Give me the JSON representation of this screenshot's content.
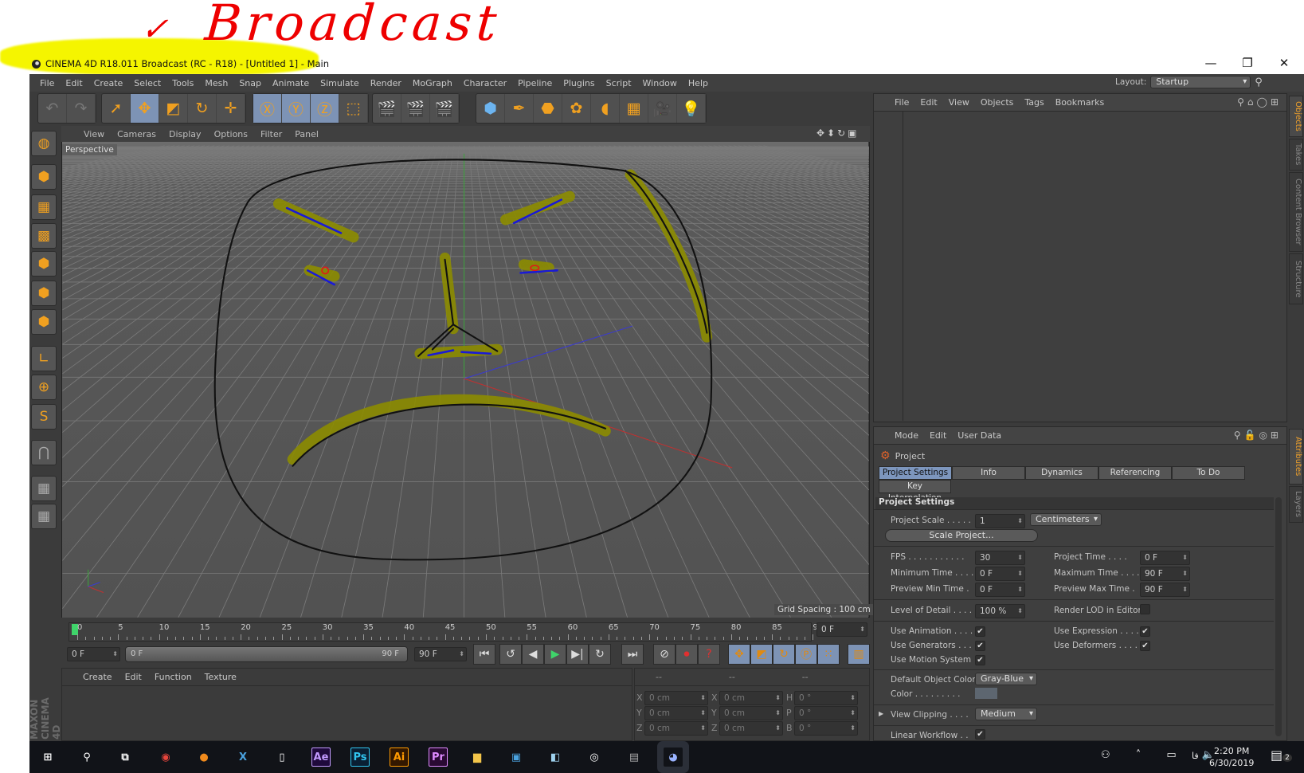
{
  "annotation": {
    "text": "Broadcast",
    "mark": "✓"
  },
  "window": {
    "title": "CINEMA 4D R18.011 Broadcast (RC - R18) - [Untitled 1] - Main",
    "minimize": "—",
    "restore": "❐",
    "close": "✕"
  },
  "menubar": [
    "File",
    "Edit",
    "Create",
    "Select",
    "Tools",
    "Mesh",
    "Snap",
    "Animate",
    "Simulate",
    "Render",
    "MoGraph",
    "Character",
    "Pipeline",
    "Plugins",
    "Script",
    "Window",
    "Help"
  ],
  "layout": {
    "label": "Layout:",
    "value": "Startup"
  },
  "toolbar_groups": [
    [
      {
        "icon": "undo-icon",
        "g": "↶"
      },
      {
        "icon": "redo-icon",
        "g": "↷"
      }
    ],
    [
      {
        "icon": "live-selection-icon",
        "g": "➚"
      },
      {
        "icon": "move-icon",
        "g": "✥",
        "sel": true
      },
      {
        "icon": "scale-icon",
        "g": "◩"
      },
      {
        "icon": "rotate-icon",
        "g": "↻"
      },
      {
        "icon": "recent-tool-icon",
        "g": "✛"
      }
    ],
    [
      {
        "icon": "x-axis-icon",
        "g": "Ⓧ",
        "sel": true
      },
      {
        "icon": "y-axis-icon",
        "g": "Ⓨ",
        "sel": true
      },
      {
        "icon": "z-axis-icon",
        "g": "Ⓩ",
        "sel": true
      },
      {
        "icon": "coordinate-system-icon",
        "g": "⬚"
      }
    ],
    [
      {
        "icon": "render-view-icon",
        "g": "🎬"
      },
      {
        "icon": "render-picture-viewer-icon",
        "g": "🎬"
      },
      {
        "icon": "render-settings-icon",
        "g": "🎬"
      }
    ],
    [
      {
        "icon": "cube-icon",
        "g": "⬢"
      },
      {
        "icon": "pen-icon",
        "g": "✒"
      },
      {
        "icon": "subdivision-icon",
        "g": "⬣"
      },
      {
        "icon": "cloner-icon",
        "g": "✿"
      },
      {
        "icon": "deformer-icon",
        "g": "◖"
      },
      {
        "icon": "floor-icon",
        "g": "▦"
      },
      {
        "icon": "camera-icon",
        "g": "🎥"
      },
      {
        "icon": "light-icon",
        "g": "💡"
      }
    ]
  ],
  "left_tools": [
    "view-icon",
    "model-mode-icon",
    "texture-mode-icon",
    "workplane-icon",
    "points-mode-icon",
    "edges-mode-icon",
    "polygons-mode-icon",
    "axis-mode-icon",
    "tweak-mode-icon",
    "solo-icon",
    "snap-icon",
    "workplane-lock-icon",
    "grid-snap-icon"
  ],
  "viewport": {
    "menu": [
      "View",
      "Cameras",
      "Display",
      "Options",
      "Filter",
      "Panel"
    ],
    "camera": "Perspective",
    "grid_spacing": "Grid Spacing : 100 cm"
  },
  "timeline": {
    "ticks": [
      "0",
      "5",
      "10",
      "15",
      "20",
      "25",
      "30",
      "35",
      "40",
      "45",
      "50",
      "55",
      "60",
      "65",
      "70",
      "75",
      "80",
      "85",
      "90"
    ],
    "current_frame": "0 F",
    "start": "0 F",
    "range_start": "0 F",
    "range_end": "90 F",
    "end": "90 F"
  },
  "material_manager": {
    "menu": [
      "Create",
      "Edit",
      "Function",
      "Texture"
    ]
  },
  "coordinates": {
    "header": [
      "--",
      "--",
      "--"
    ],
    "rows": [
      [
        "X",
        "0 cm",
        "X",
        "0 cm",
        "H",
        "0 °"
      ],
      [
        "Y",
        "0 cm",
        "Y",
        "0 cm",
        "P",
        "0 °"
      ],
      [
        "Z",
        "0 cm",
        "Z",
        "0 cm",
        "B",
        "0 °"
      ]
    ]
  },
  "brand": "MAXON CINEMA 4D",
  "object_manager": {
    "menu": [
      "File",
      "Edit",
      "View",
      "Objects",
      "Tags",
      "Bookmarks"
    ]
  },
  "side_tabs_top": [
    {
      "label": "Objects",
      "active": true
    },
    {
      "label": "Takes"
    },
    {
      "label": "Content Browser"
    },
    {
      "label": "Structure"
    }
  ],
  "side_tabs_bottom": [
    {
      "label": "Attributes",
      "active": true
    },
    {
      "label": "Layers"
    }
  ],
  "attributes": {
    "menu": [
      "Mode",
      "Edit",
      "User Data"
    ],
    "object": "Project",
    "tabs": [
      "Project Settings",
      "Info",
      "Dynamics",
      "Referencing",
      "To Do"
    ],
    "tab2": "Key Interpolation",
    "group": "Project Settings",
    "project_scale": {
      "label": "Project Scale",
      "value": "1",
      "unit": "Centimeters"
    },
    "scale_button": "Scale Project...",
    "fps": {
      "label": "FPS",
      "value": "30"
    },
    "project_time": {
      "label": "Project Time",
      "value": "0 F"
    },
    "min_time": {
      "label": "Minimum Time",
      "value": "0 F"
    },
    "max_time": {
      "label": "Maximum Time",
      "value": "90 F"
    },
    "prev_min": {
      "label": "Preview Min Time",
      "value": "0 F"
    },
    "prev_max": {
      "label": "Preview Max Time",
      "value": "90 F"
    },
    "lod": {
      "label": "Level of Detail",
      "value": "100 %"
    },
    "render_lod": {
      "label": "Render LOD in Editor",
      "checked": false
    },
    "use_animation": {
      "label": "Use Animation",
      "checked": true
    },
    "use_expression": {
      "label": "Use Expression",
      "checked": true
    },
    "use_generators": {
      "label": "Use Generators",
      "checked": true
    },
    "use_deformers": {
      "label": "Use Deformers",
      "checked": true
    },
    "use_motion": {
      "label": "Use Motion System",
      "checked": true
    },
    "default_color": {
      "label": "Default Object Color",
      "value": "Gray-Blue"
    },
    "color": {
      "label": "Color",
      "swatch": "#5d6670"
    },
    "view_clipping": {
      "label": "View Clipping",
      "value": "Medium"
    },
    "linear_workflow": {
      "label": "Linear Workflow",
      "checked": true
    },
    "check": "✔"
  },
  "taskbar": {
    "icons": [
      {
        "name": "start-icon",
        "g": "⊞",
        "c": "#fff"
      },
      {
        "name": "search-icon",
        "g": "⚲",
        "c": "#fff"
      },
      {
        "name": "task-view-icon",
        "g": "⧉",
        "c": "#fff"
      },
      {
        "name": "chrome-icon",
        "g": "◉",
        "c": "#e8453c"
      },
      {
        "name": "fl-studio-icon",
        "g": "●",
        "c": "#f08a1c"
      },
      {
        "name": "x-app-icon",
        "g": "X",
        "c": "#4aa3e0"
      },
      {
        "name": "file-icon",
        "g": "▯",
        "c": "#fff"
      },
      {
        "name": "after-effects-icon",
        "g": "Ae",
        "c": "#c39bff",
        "bg": "#1f0a3c"
      },
      {
        "name": "photoshop-icon",
        "g": "Ps",
        "c": "#31c5f0",
        "bg": "#0a1f33"
      },
      {
        "name": "illustrator-icon",
        "g": "Ai",
        "c": "#ff9a00",
        "bg": "#331800"
      },
      {
        "name": "premiere-icon",
        "g": "Pr",
        "c": "#e08bff",
        "bg": "#2a0a33"
      },
      {
        "name": "file-explorer-icon",
        "g": "▆",
        "c": "#f3c54a"
      },
      {
        "name": "control-panel-icon",
        "g": "▣",
        "c": "#4aa3e0"
      },
      {
        "name": "notes-icon",
        "g": "◧",
        "c": "#9fd3ef"
      },
      {
        "name": "target-app-icon",
        "g": "◎",
        "c": "#fff"
      },
      {
        "name": "monitor-app-icon",
        "g": "▤",
        "c": "#aaa"
      },
      {
        "name": "cinema4d-icon",
        "g": "◕",
        "c": "#9ab3ff"
      }
    ],
    "time": "2:20 PM",
    "date": "6/30/2019",
    "lang": "فا",
    "notifications": "2"
  }
}
